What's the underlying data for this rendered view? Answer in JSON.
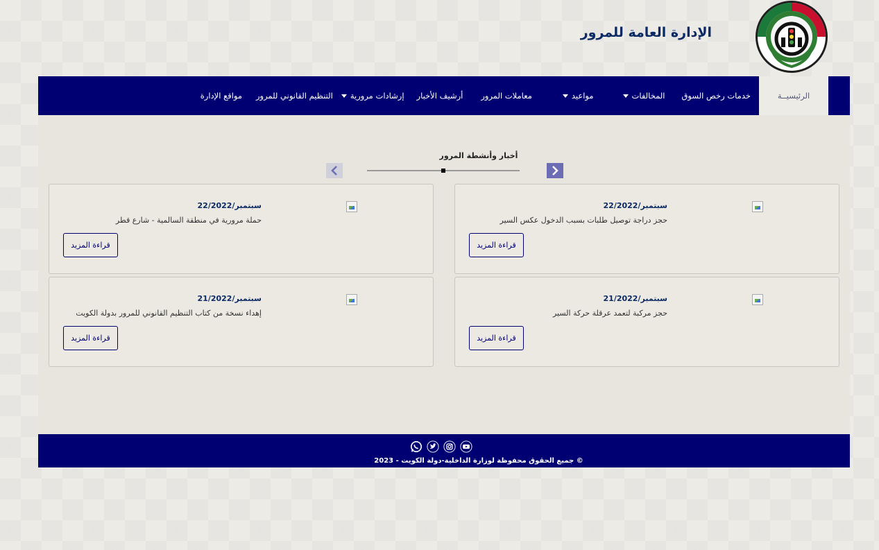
{
  "header": {
    "title": "الإدارة العامة للمرور",
    "logo_icon": "traffic-department-emblem-icon",
    "logo_text": "الإدارة العامة للمرور - قطاع شؤون المرور والعمليات"
  },
  "nav": {
    "items": [
      {
        "label": "الرئيسيــة",
        "active": true
      },
      {
        "label": "خدمات رخص السوق"
      },
      {
        "label": "المخالفات",
        "dropdown": true
      },
      {
        "label": "مواعيد",
        "dropdown": true
      },
      {
        "label": "معاملات المرور"
      },
      {
        "label": "أرشيف الأخبار"
      },
      {
        "label": "إرشادات مرورية",
        "dropdown": true
      },
      {
        "label": "التنظيم القانوني للمرور"
      },
      {
        "label": "مواقع الإدارة"
      }
    ]
  },
  "news": {
    "section_title": "أخبار وأنشطة المرور",
    "next_icon": "chevron-right-icon",
    "prev_icon": "chevron-left-icon",
    "cards": [
      {
        "date": "22/سبتمبر/2022",
        "headline": "حجز دراجة توصيل طلبات بسبب الدخول عكس السير",
        "button": "قراءة المزيد"
      },
      {
        "date": "22/سبتمبر/2022",
        "headline": "حملة مرورية في منطقة السالمية - شارع قطر",
        "button": "قراءة المزيد"
      },
      {
        "date": "21/سبتمبر/2022",
        "headline": "حجز مركبة لتعمد عرقلة حركة السير",
        "button": "قراءة المزيد"
      },
      {
        "date": "21/سبتمبر/2022",
        "headline": "إهداء نسخة من كتاب التنظيم القانوني للمرور بدولة الكويت",
        "button": "قراءة المزيد"
      }
    ]
  },
  "footer": {
    "social": [
      "youtube-icon",
      "instagram-icon",
      "twitter-icon",
      "whatsapp-icon"
    ],
    "copyright": "© جميع الحقوق محفوظة لوزارة الداخلية-دولة الكويت - 2023"
  },
  "colors": {
    "nav_bg": "#000073",
    "title": "#0c2a63",
    "page_bg": "#ecebe6"
  }
}
